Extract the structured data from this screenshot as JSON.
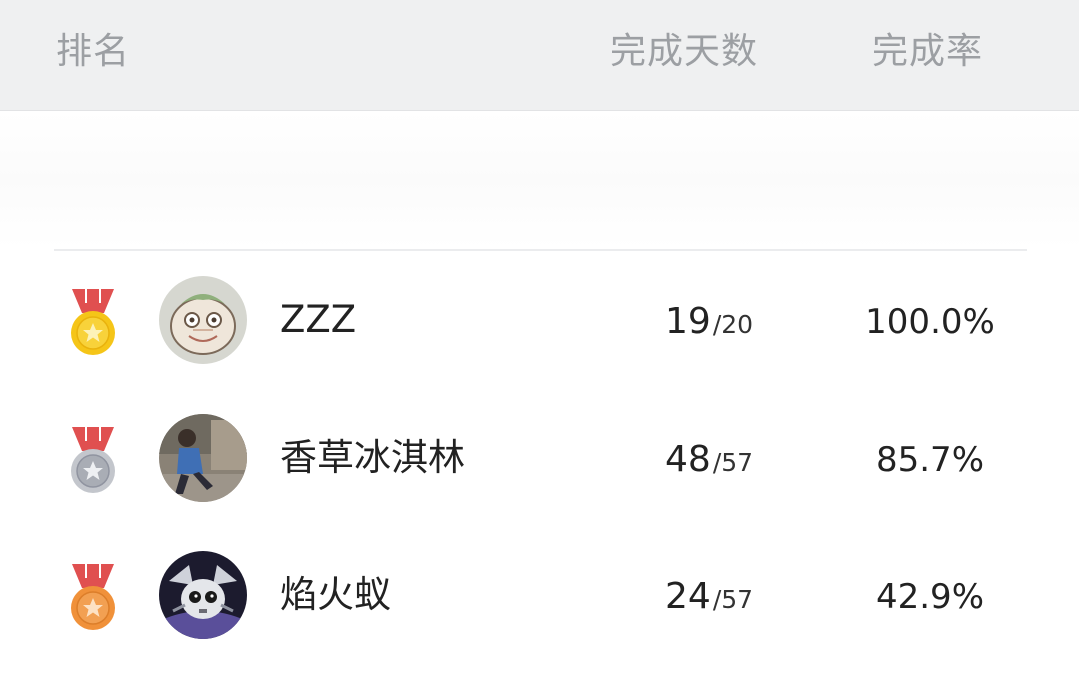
{
  "header": {
    "rank_label": "排名",
    "days_label": "完成天数",
    "rate_label": "完成率"
  },
  "colors": {
    "header_bg": "#eff0f1",
    "header_text": "#9c9fa3",
    "gold": "#f5c518",
    "silver": "#c3c6cc",
    "bronze": "#f0913a",
    "ribbon": "#e05050"
  },
  "rows": [
    {
      "rank_icon": "gold-medal-icon",
      "name": "ZZZ",
      "days_done": "19",
      "days_total": "20",
      "rate": "100.0%"
    },
    {
      "rank_icon": "silver-medal-icon",
      "name": "香草冰淇林",
      "days_done": "48",
      "days_total": "57",
      "rate": "85.7%"
    },
    {
      "rank_icon": "bronze-medal-icon",
      "name": "焰火蚁",
      "days_done": "24",
      "days_total": "57",
      "rate": "42.9%"
    }
  ]
}
